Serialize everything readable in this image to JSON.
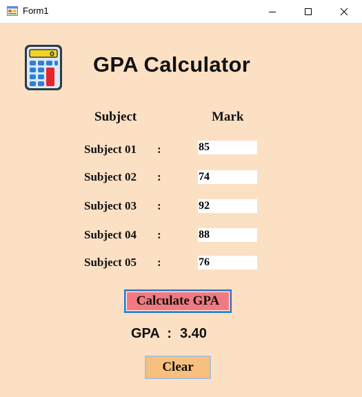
{
  "window": {
    "title": "Form1",
    "icon": "winforms-app-icon",
    "controls": [
      "minimize-icon",
      "maximize-icon",
      "close-icon"
    ]
  },
  "app": {
    "title": "GPA Calculator",
    "icon": "calculator-icon",
    "calculator_display": "0"
  },
  "table": {
    "subject_header": "Subject",
    "mark_header": "Mark",
    "colon": ":",
    "rows": [
      {
        "label": "Subject 01",
        "mark": "85"
      },
      {
        "label": "Subject 02",
        "mark": "74"
      },
      {
        "label": "Subject 03",
        "mark": "92"
      },
      {
        "label": "Subject 04",
        "mark": "88"
      },
      {
        "label": "Subject 05",
        "mark": "76"
      }
    ]
  },
  "actions": {
    "calculate_label": "Calculate GPA",
    "clear_label": "Clear"
  },
  "result": {
    "label": "GPA  :",
    "value": "3.40"
  },
  "colors": {
    "background": "#fce0c4",
    "calculate_button": "#f07a80",
    "calculate_border": "#1e7bd6",
    "clear_button": "#f8bf7e"
  }
}
